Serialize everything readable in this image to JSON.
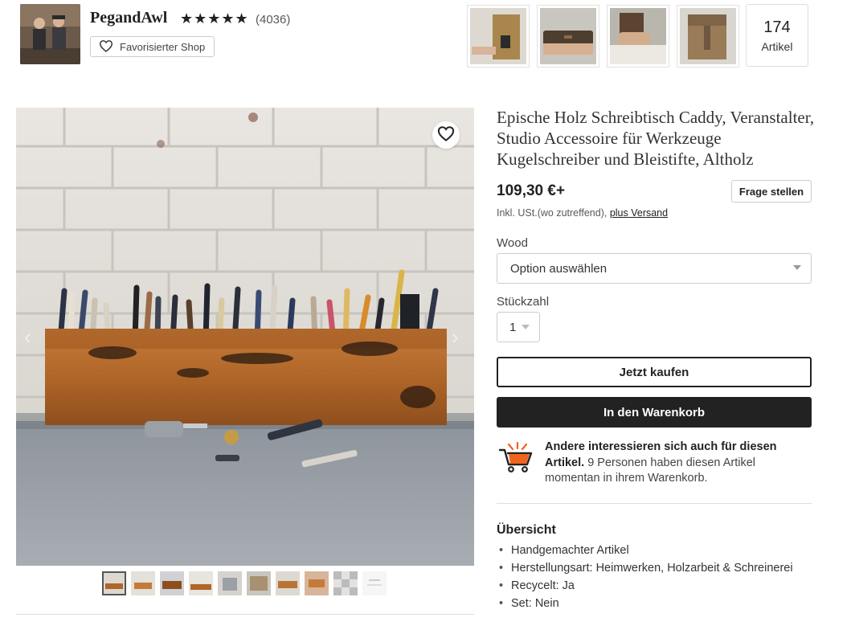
{
  "header": {
    "shop_name": "PegandAwl",
    "stars": "★★★★★",
    "review_count": "(4036)",
    "favorite_shop_label": "Favorisierter Shop",
    "item_count": "174",
    "item_count_label": "Artikel"
  },
  "listing": {
    "title": "Epische Holz Schreibtisch Caddy, Veranstalter, Studio Accessoire für Werkzeuge Kugelschreiber und Bleistifte, Altholz",
    "price": "109,30 €+",
    "ask_question_label": "Frage stellen",
    "tax_note": "Inkl. USt.(wo zutreffend),",
    "shipping_link": "plus Versand",
    "variation_label": "Wood",
    "variation_placeholder": "Option auswählen",
    "quantity_label": "Stückzahl",
    "quantity_value": "1",
    "buy_now_label": "Jetzt kaufen",
    "add_to_cart_label": "In den Warenkorb",
    "social_bold": "Andere interessieren sich auch für diesen Artikel.",
    "social_text": "9 Personen haben diesen Artikel momentan in ihrem Warenkorb.",
    "overview_title": "Übersicht",
    "overview_items": [
      "Handgemachter Artikel",
      "Herstellungsart: Heimwerken, Holzarbeit & Schreinerei",
      "Recycelt: Ja",
      "Set: Nein"
    ]
  },
  "icons": {
    "favorite": "heart-icon",
    "cart": "shopping-cart-icon",
    "prev": "chevron-left-icon",
    "next": "chevron-right-icon"
  },
  "colors": {
    "primary_button": "#222222",
    "text": "#222222"
  }
}
